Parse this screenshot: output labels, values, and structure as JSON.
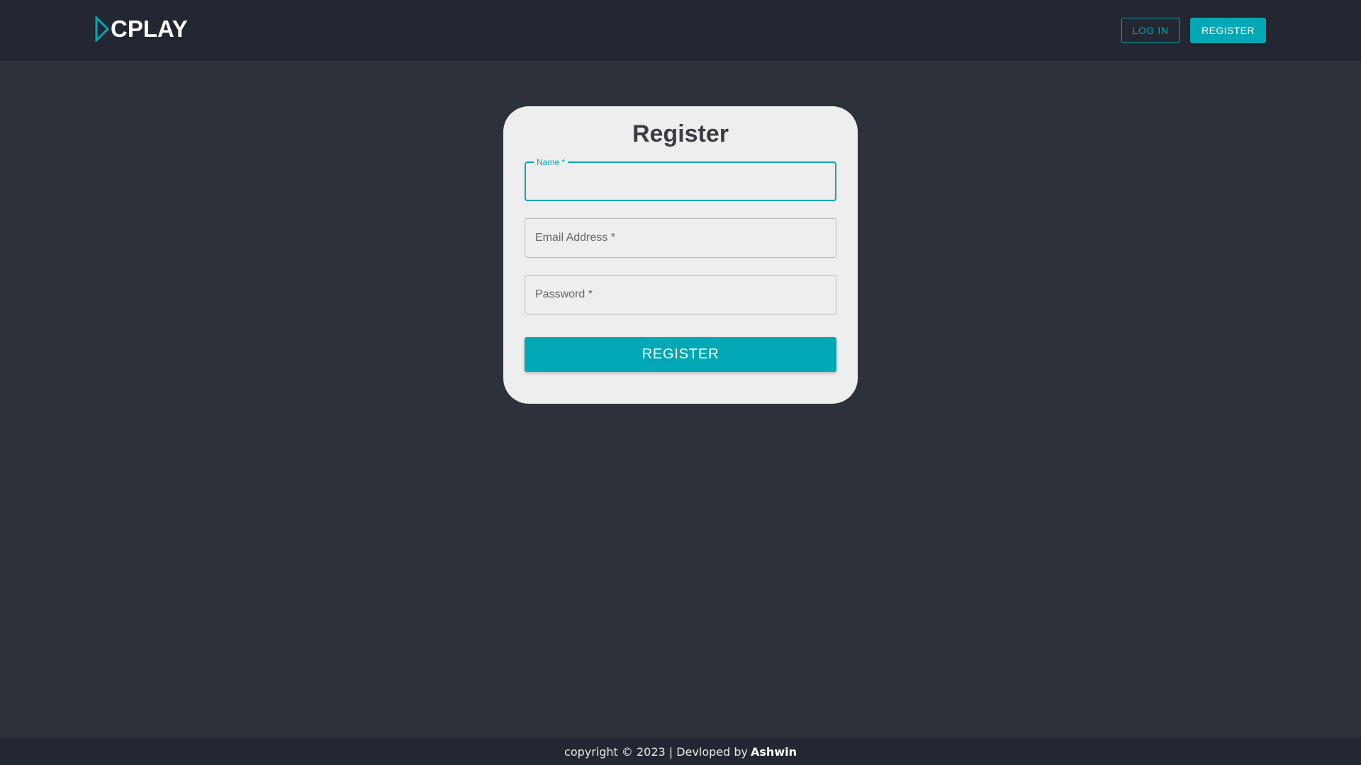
{
  "brand": {
    "name": "CPLAY",
    "logo_icon": "play-triangle-icon",
    "accent_color": "#00a8b5"
  },
  "nav": {
    "login_label": "LOG IN",
    "register_label": "REGISTER"
  },
  "form": {
    "title": "Register",
    "fields": [
      {
        "label": "Name *",
        "value": ""
      },
      {
        "label": "Email Address *",
        "value": ""
      },
      {
        "label": "Password *",
        "value": ""
      }
    ],
    "submit_label": "REGISTER"
  },
  "footer": {
    "text": "copyright © 2023 | Devloped by",
    "author": "Ashwin"
  }
}
